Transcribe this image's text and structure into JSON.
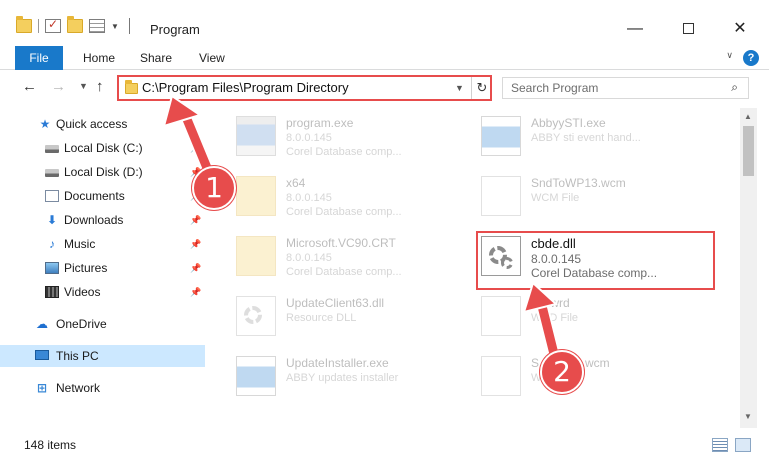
{
  "window": {
    "title": "Program",
    "minimize_glyph": "—",
    "close_glyph": "✕"
  },
  "ribbon": {
    "tabs": [
      {
        "label": "File"
      },
      {
        "label": "Home"
      },
      {
        "label": "Share"
      },
      {
        "label": "View"
      }
    ],
    "help_glyph": "?"
  },
  "address": {
    "path": "C:\\Program Files\\Program Directory",
    "search_placeholder": "Search Program"
  },
  "nav": {
    "items": [
      {
        "label": "Quick access",
        "icon": "star-icon"
      },
      {
        "label": "Local Disk (C:)",
        "icon": "drive-icon",
        "pinned": true
      },
      {
        "label": "Local Disk (D:)",
        "icon": "drive-icon",
        "pinned": true
      },
      {
        "label": "Documents",
        "icon": "documents-icon",
        "pinned": true
      },
      {
        "label": "Downloads",
        "icon": "downloads-icon",
        "pinned": true
      },
      {
        "label": "Music",
        "icon": "music-icon",
        "pinned": true
      },
      {
        "label": "Pictures",
        "icon": "pictures-icon",
        "pinned": true
      },
      {
        "label": "Videos",
        "icon": "videos-icon",
        "pinned": true
      },
      {
        "label": "OneDrive",
        "icon": "cloud-icon"
      },
      {
        "label": "This PC",
        "icon": "computer-icon",
        "selected": true
      },
      {
        "label": "Network",
        "icon": "network-icon"
      }
    ]
  },
  "files": [
    {
      "name": "program.exe",
      "line1": "8.0.0.145",
      "line2": "Corel Database comp...",
      "icon": "exe-icon"
    },
    {
      "name": "AbbyySTI.exe",
      "line1": "ABBY sti event hand...",
      "line2": "",
      "icon": "exe-icon"
    },
    {
      "name": "x64",
      "line1": "8.0.0.145",
      "line2": "Corel Database comp...",
      "icon": "folder-icon"
    },
    {
      "name": "SndToWP13.wcm",
      "line1": "WCM File",
      "line2": "",
      "icon": "file-icon"
    },
    {
      "name": "Microsoft.VC90.CRT",
      "line1": "8.0.0.145",
      "line2": "Corel Database comp...",
      "icon": "folder-icon"
    },
    {
      "name": "cbde.dll",
      "line1": "8.0.0.145",
      "line2": "Corel Database comp...",
      "icon": "dll-gear-icon",
      "highlighted": true
    },
    {
      "name": "UpdateClient63.dll",
      "line1": "Resource DLL",
      "line2": "",
      "icon": "dll-gear-icon"
    },
    {
      "name": "...c.wrd",
      "line1": "WRD File",
      "line2": "",
      "icon": "file-icon"
    },
    {
      "name": "UpdateInstaller.exe",
      "line1": "ABBY updates installer",
      "line2": "",
      "icon": "exe-icon"
    },
    {
      "name": "S...WP16.wcm",
      "line1": "W...",
      "line2": "",
      "icon": "file-icon"
    }
  ],
  "status": {
    "item_count": "148 items"
  },
  "annotations": {
    "step1": "1",
    "step2": "2",
    "color": "#e74c4c"
  },
  "colors": {
    "accent": "#1979ca",
    "selection": "#cce8ff",
    "highlight": "#e74c4c"
  }
}
